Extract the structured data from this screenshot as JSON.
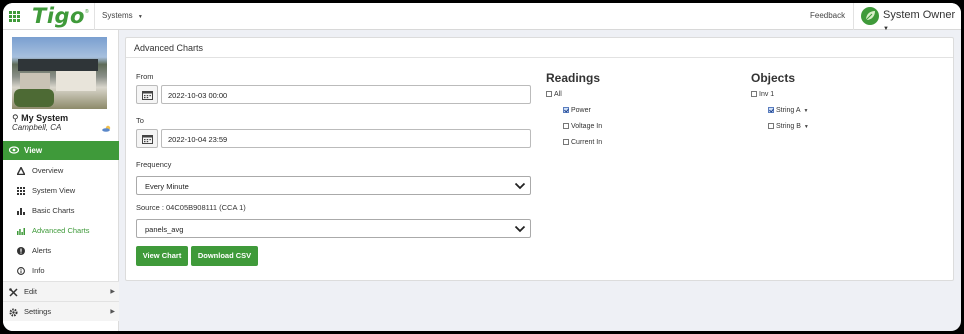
{
  "topbar": {
    "logo": "Tigo",
    "systems_label": "Systems",
    "feedback_label": "Feedback",
    "user_role": "System Owner"
  },
  "sidebar": {
    "system_name": "My System",
    "system_location": "Campbell, CA",
    "view_label": "View",
    "view_items": [
      {
        "label": "Overview",
        "icon": "warning-triangle-icon"
      },
      {
        "label": "System View",
        "icon": "grid-dots-icon"
      },
      {
        "label": "Basic Charts",
        "icon": "bar-chart-icon"
      },
      {
        "label": "Advanced Charts",
        "icon": "bar-chart-icon",
        "active": true
      },
      {
        "label": "Alerts",
        "icon": "alert-circle-icon"
      },
      {
        "label": "Info",
        "icon": "info-circle-icon"
      }
    ],
    "edit_label": "Edit",
    "settings_label": "Settings"
  },
  "panel": {
    "title": "Advanced Charts",
    "from_label": "From",
    "from_value": "2022-10-03 00:00",
    "to_label": "To",
    "to_value": "2022-10-04 23:59",
    "frequency_label": "Frequency",
    "frequency_value": "Every Minute",
    "source_label": "Source : 04C05B908111 (CCA 1)",
    "source_value": "panels_avg",
    "view_chart_label": "View Chart",
    "download_csv_label": "Download CSV",
    "readings": {
      "heading": "Readings",
      "all": {
        "label": "All",
        "checked": false
      },
      "items": [
        {
          "label": "Power",
          "checked": true
        },
        {
          "label": "Voltage In",
          "checked": false
        },
        {
          "label": "Current In",
          "checked": false
        }
      ]
    },
    "objects": {
      "heading": "Objects",
      "inverter": {
        "label": "Inv 1",
        "checked": false
      },
      "items": [
        {
          "label": "String A",
          "checked": true
        },
        {
          "label": "String B",
          "checked": false
        }
      ]
    }
  },
  "colors": {
    "brand_green": "#3f9a3a",
    "background": "#eef0f5"
  }
}
